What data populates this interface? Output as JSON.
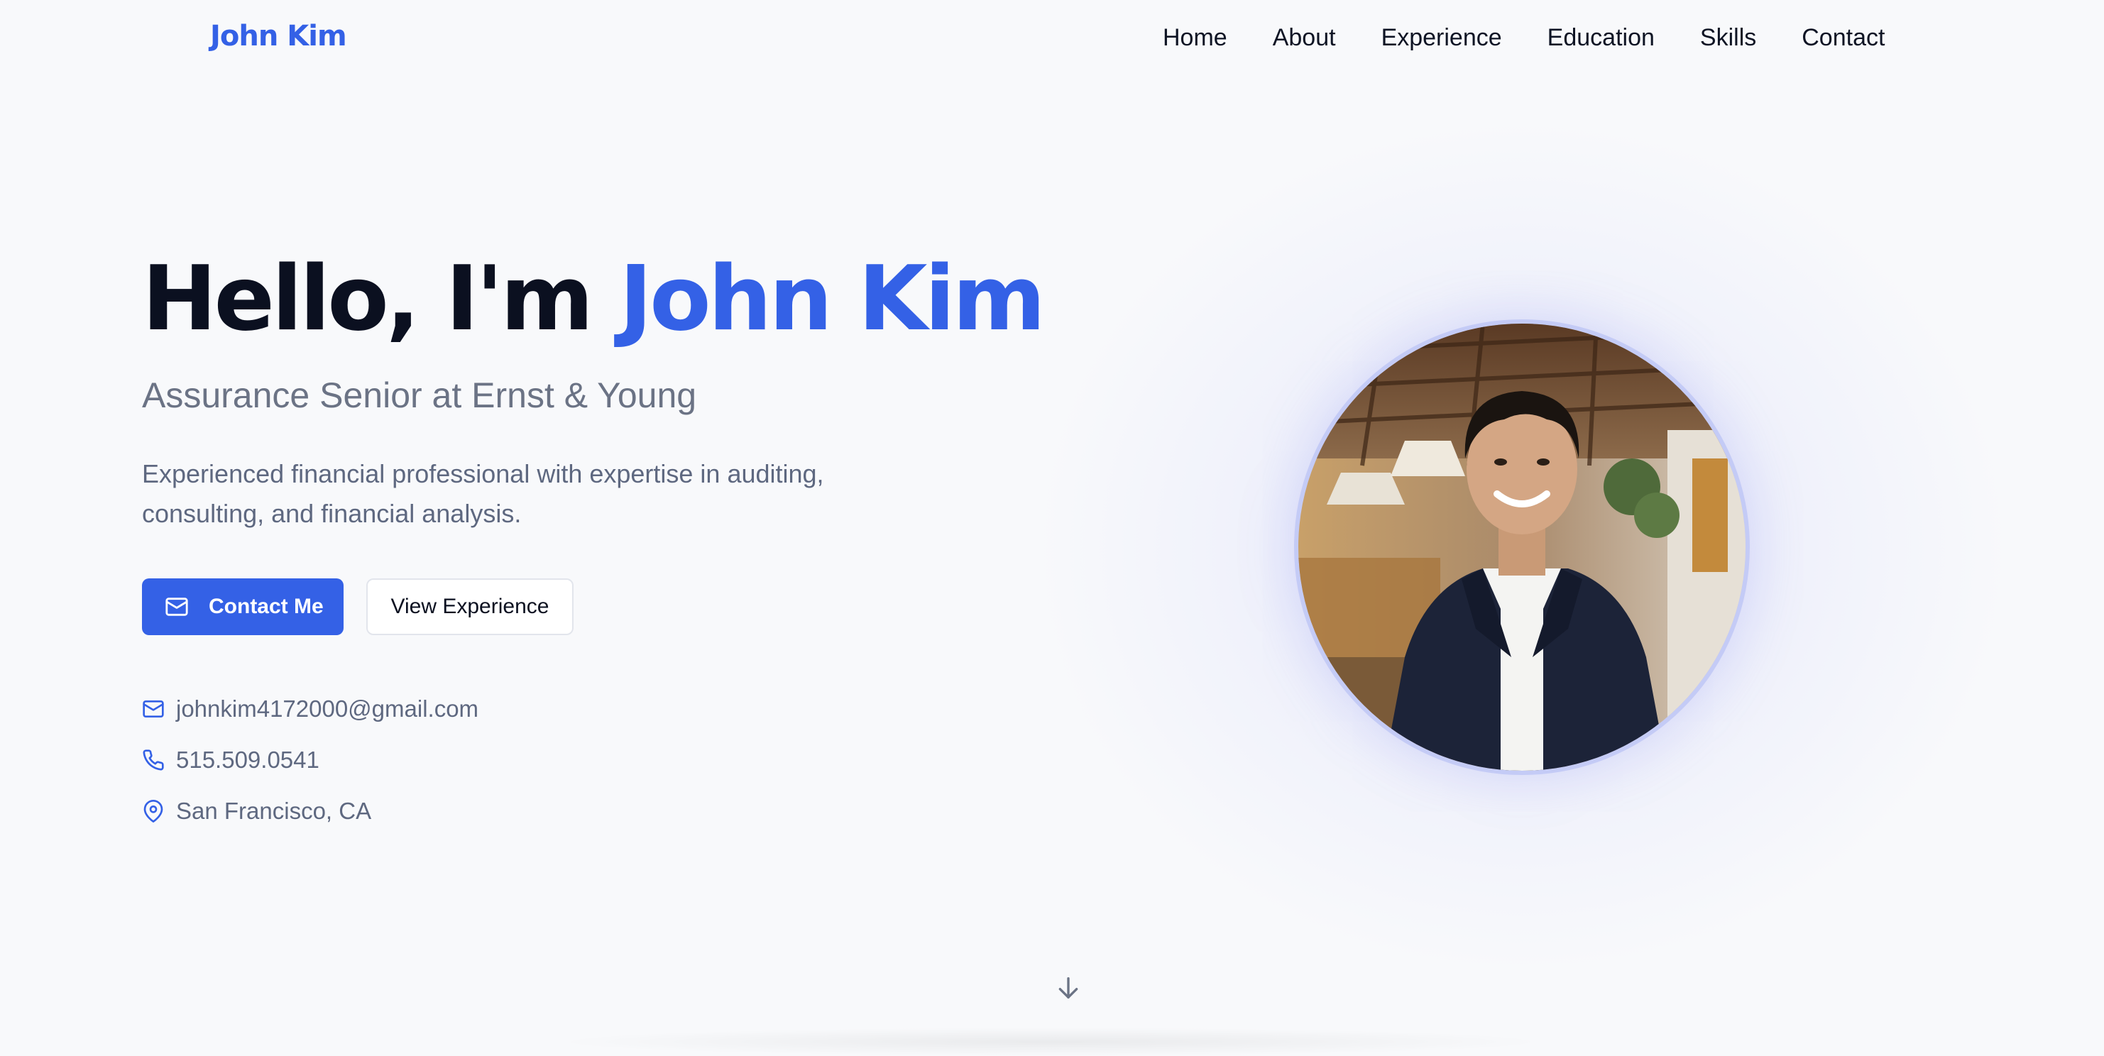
{
  "nav": {
    "brand": "John Kim",
    "items": [
      {
        "label": "Home"
      },
      {
        "label": "About"
      },
      {
        "label": "Experience"
      },
      {
        "label": "Education"
      },
      {
        "label": "Skills"
      },
      {
        "label": "Contact"
      }
    ]
  },
  "hero": {
    "greeting": "Hello, I'm ",
    "name": "John Kim",
    "subtitle": "Assurance Senior at Ernst & Young",
    "description": "Experienced financial professional with expertise in auditing, consulting, and financial analysis.",
    "primary_button": "Contact Me",
    "secondary_button": "View Experience"
  },
  "contact": {
    "email": "johnkim4172000@gmail.com",
    "phone": "515.509.0541",
    "location": "San Francisco, CA"
  },
  "icons": {
    "button": "mail-icon",
    "email": "mail-icon",
    "phone": "phone-icon",
    "location": "map-pin-icon",
    "scroll": "arrow-down-icon"
  },
  "colors": {
    "accent": "#3461e6",
    "background": "#f8f9fb",
    "text_dark": "#0b1020",
    "text_muted": "#5e6880",
    "ring": "#c4cbf6"
  }
}
